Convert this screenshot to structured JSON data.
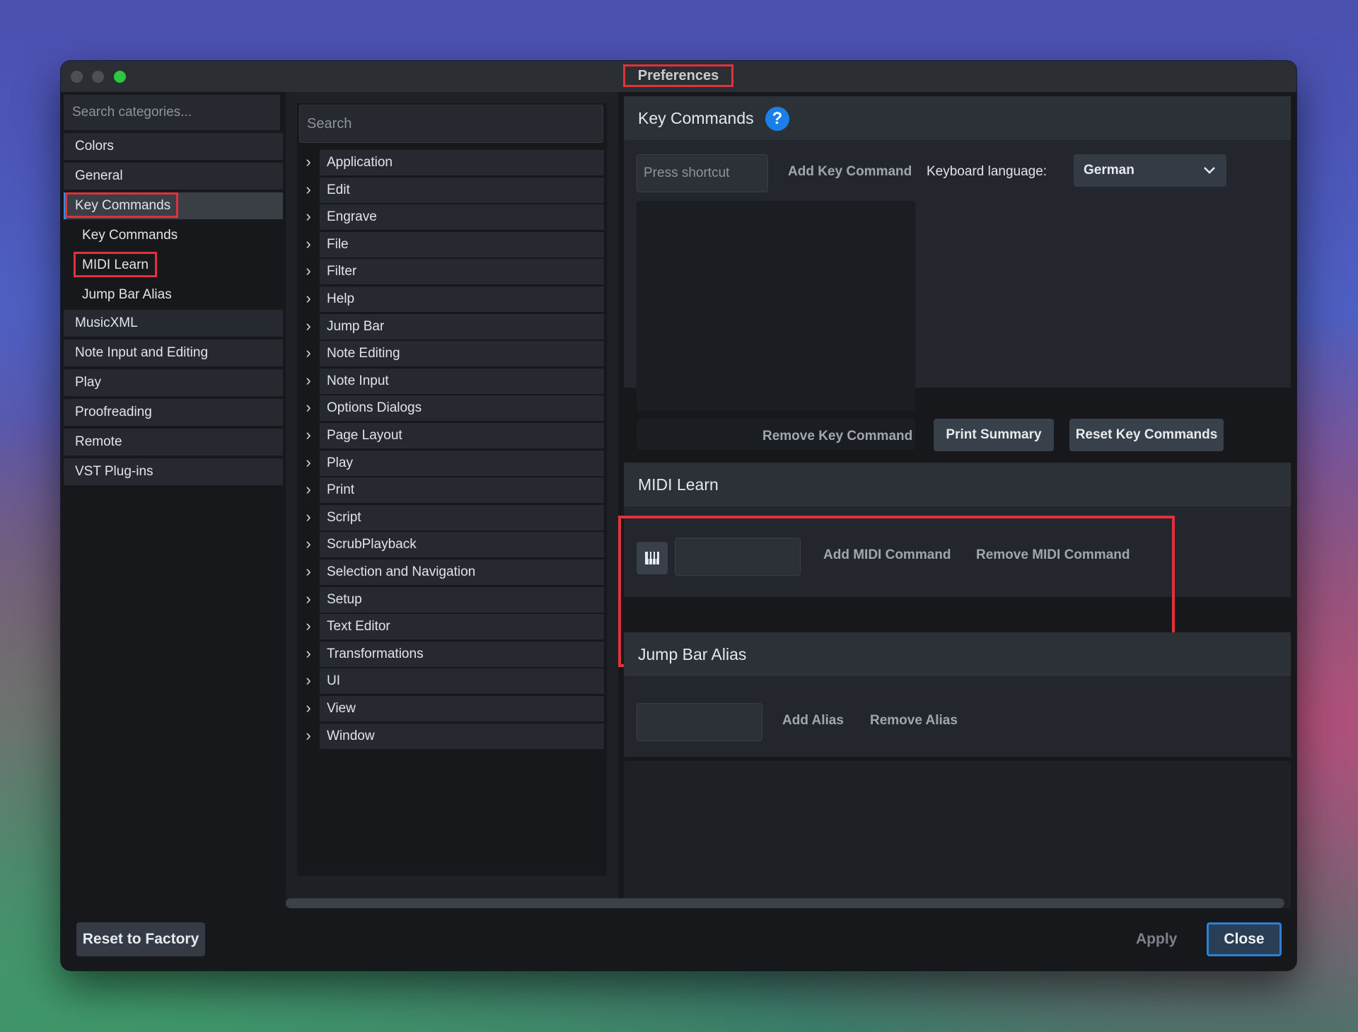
{
  "window": {
    "title": "Preferences"
  },
  "sidebar": {
    "search_placeholder": "Search categories...",
    "items": [
      {
        "label": "Colors"
      },
      {
        "label": "General"
      },
      {
        "label": "Key Commands",
        "selected": true
      },
      {
        "label": "MusicXML"
      },
      {
        "label": "Note Input and Editing"
      },
      {
        "label": "Play"
      },
      {
        "label": "Proofreading"
      },
      {
        "label": "Remote"
      },
      {
        "label": "VST Plug-ins"
      }
    ],
    "subitems": [
      {
        "label": "Key Commands"
      },
      {
        "label": "MIDI Learn"
      },
      {
        "label": "Jump Bar Alias"
      }
    ]
  },
  "commands_tree": {
    "search_placeholder": "Search",
    "items": [
      "Application",
      "Edit",
      "Engrave",
      "File",
      "Filter",
      "Help",
      "Jump Bar",
      "Note Editing",
      "Note Input",
      "Options Dialogs",
      "Page Layout",
      "Play",
      "Print",
      "Script",
      "ScrubPlayback",
      "Selection and Navigation",
      "Setup",
      "Text Editor",
      "Transformations",
      "UI",
      "View",
      "Window"
    ],
    "chevron": "›"
  },
  "key_commands": {
    "title": "Key Commands",
    "help_icon": "?",
    "shortcut_placeholder": "Press shortcut",
    "add_label": "Add Key Command",
    "keyboard_language_label": "Keyboard language:",
    "keyboard_language_value": "German",
    "remove_label": "Remove Key Command",
    "print_summary_label": "Print Summary",
    "reset_label": "Reset Key Commands"
  },
  "midi_learn": {
    "title": "MIDI Learn",
    "icon": "piano-keys-icon",
    "add_label": "Add MIDI Command",
    "remove_label": "Remove MIDI Command"
  },
  "jump_bar_alias": {
    "title": "Jump Bar Alias",
    "add_label": "Add Alias",
    "remove_label": "Remove Alias"
  },
  "footer": {
    "reset_factory_label": "Reset to Factory",
    "apply_label": "Apply",
    "close_label": "Close"
  },
  "colors": {
    "highlight_border": "#e0323c",
    "accent_blue": "#2f8ee6",
    "traffic_green": "#2cc840"
  }
}
